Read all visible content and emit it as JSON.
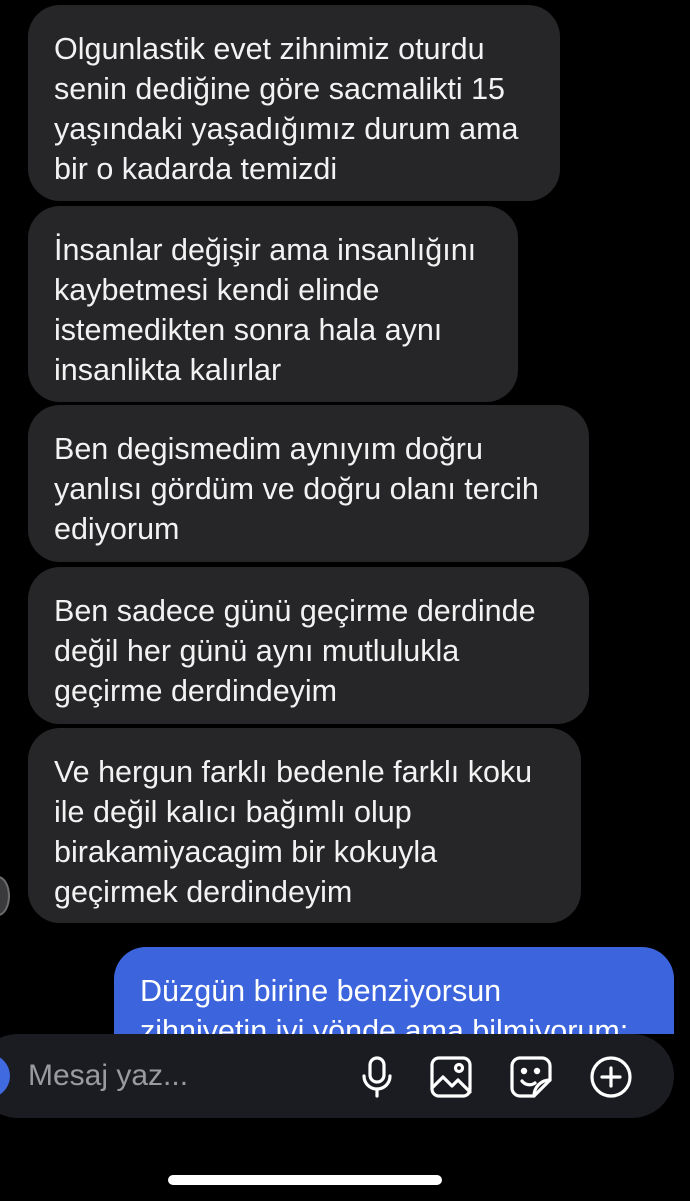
{
  "messages": [
    {
      "direction": "incoming",
      "text": "Olgunlastik evet zihnimiz oturdu\nsenin dediğine göre sacmalikti 15\nyaşındaki yaşadığımız durum ama\nbir o kadarda temizdi"
    },
    {
      "direction": "incoming",
      "text": "İnsanlar değişir ama insanlığını\nkaybetmesi kendi elinde\nistemedikten sonra hala aynı\ninsanlikta kalırlar"
    },
    {
      "direction": "incoming",
      "text": "Ben degismedim aynıyım doğru\nyanlısı gördüm ve doğru olanı tercih\nediyorum"
    },
    {
      "direction": "incoming",
      "text": "Ben sadece günü geçirme derdinde\ndeğil her günü aynı mutlulukla\ngeçirme derdindeyim"
    },
    {
      "direction": "incoming",
      "text": "Ve hergun farklı bedenle farklı koku\nile değil kalıcı bağımlı olup\nbirakamiyacagim bir kokuyla\ngeçirmek derdindeyim"
    },
    {
      "direction": "outgoing",
      "text": "Düzgün birine benziyorsun\nzihniyetin iyi yönde ama bilmiyorum;"
    }
  ],
  "composer": {
    "placeholder": "Mesaj yaz...",
    "icons": [
      "microphone-icon",
      "gallery-icon",
      "sticker-icon",
      "add-circle-icon"
    ]
  },
  "colors": {
    "background": "#000000",
    "incoming_bubble": "#262628",
    "outgoing_bubble": "#3b64dd",
    "composer": "#1b1c22"
  }
}
